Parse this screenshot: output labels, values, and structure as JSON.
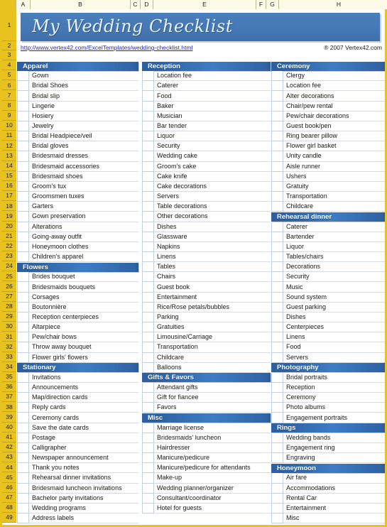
{
  "document": {
    "title": "My Wedding Checklist",
    "url": "http://www.vertex42.com/ExcelTemplates/wedding-checklist.html",
    "copyright": "® 2007 Vertex42.com"
  },
  "colors": {
    "banner_blue": "#4a7ebb",
    "section_blue": "#2f62a3",
    "frame_yellow": "#e8c21e",
    "link_blue": "#2a2ab4"
  },
  "column_headers": [
    "A",
    "B",
    "C",
    "D",
    "E",
    "F",
    "G",
    "H"
  ],
  "row_numbers": [
    1,
    2,
    3,
    4,
    5,
    6,
    7,
    8,
    9,
    10,
    11,
    12,
    13,
    14,
    15,
    16,
    17,
    18,
    19,
    20,
    21,
    22,
    23,
    24,
    25,
    26,
    27,
    28,
    29,
    30,
    31,
    32,
    33,
    34,
    35,
    36,
    37,
    38,
    39,
    40,
    41,
    42,
    43,
    44,
    45,
    46,
    47,
    48,
    49
  ],
  "columns": {
    "left": [
      {
        "type": "section",
        "label": "Apparel"
      },
      {
        "type": "item",
        "label": "Gown"
      },
      {
        "type": "item",
        "label": "Bridal Shoes"
      },
      {
        "type": "item",
        "label": "Bridal slip"
      },
      {
        "type": "item",
        "label": "Lingerie"
      },
      {
        "type": "item",
        "label": "Hosiery"
      },
      {
        "type": "item",
        "label": "Jewelry"
      },
      {
        "type": "item",
        "label": "Bridal Headpiece/veil"
      },
      {
        "type": "item",
        "label": "Bridal gloves"
      },
      {
        "type": "item",
        "label": "Bridesmaid dresses"
      },
      {
        "type": "item",
        "label": "Bridesmaid accessories"
      },
      {
        "type": "item",
        "label": "Bridesmaid shoes"
      },
      {
        "type": "item",
        "label": "Groom's tux"
      },
      {
        "type": "item",
        "label": "Groomsmen tuxes"
      },
      {
        "type": "item",
        "label": "Garters"
      },
      {
        "type": "item",
        "label": "Gown preservation"
      },
      {
        "type": "item",
        "label": "Alterations"
      },
      {
        "type": "item",
        "label": "Going-away outfit"
      },
      {
        "type": "item",
        "label": "Honeymoon clothes"
      },
      {
        "type": "item",
        "label": "Children's apparel"
      },
      {
        "type": "section",
        "label": "Flowers"
      },
      {
        "type": "item",
        "label": "Brides bouquet"
      },
      {
        "type": "item",
        "label": "Bridesmaids bouquets"
      },
      {
        "type": "item",
        "label": "Corsages"
      },
      {
        "type": "item",
        "label": "Boutonnière"
      },
      {
        "type": "item",
        "label": "Reception centerpieces"
      },
      {
        "type": "item",
        "label": "Altarpiece"
      },
      {
        "type": "item",
        "label": "Pew/chair bows"
      },
      {
        "type": "item",
        "label": "Throw away bouquet"
      },
      {
        "type": "item",
        "label": "Flower girls' flowers"
      },
      {
        "type": "section",
        "label": "Stationary"
      },
      {
        "type": "item",
        "label": "Invitations"
      },
      {
        "type": "item",
        "label": "Announcements"
      },
      {
        "type": "item",
        "label": "Map/direction cards"
      },
      {
        "type": "item",
        "label": "Reply cards"
      },
      {
        "type": "item",
        "label": "Ceremony cards"
      },
      {
        "type": "item",
        "label": "Save the date cards"
      },
      {
        "type": "item",
        "label": "Postage"
      },
      {
        "type": "item",
        "label": "Calligrapher"
      },
      {
        "type": "item",
        "label": "Newspaper announcement"
      },
      {
        "type": "item",
        "label": "Thank you notes"
      },
      {
        "type": "item",
        "label": "Rehearsal dinner invitations"
      },
      {
        "type": "item",
        "label": "Bridesmaid luncheon invitations"
      },
      {
        "type": "item",
        "label": "Bachelor party invitations"
      },
      {
        "type": "item",
        "label": "Wedding programs"
      },
      {
        "type": "item",
        "label": "Address labels"
      }
    ],
    "middle": [
      {
        "type": "section",
        "label": "Reception"
      },
      {
        "type": "item",
        "label": "Location fee"
      },
      {
        "type": "item",
        "label": "Caterer"
      },
      {
        "type": "item",
        "label": "Food"
      },
      {
        "type": "item",
        "label": "Baker"
      },
      {
        "type": "item",
        "label": "Musician"
      },
      {
        "type": "item",
        "label": "Bar tender"
      },
      {
        "type": "item",
        "label": "Liquor"
      },
      {
        "type": "item",
        "label": "Security"
      },
      {
        "type": "item",
        "label": "Wedding cake"
      },
      {
        "type": "item",
        "label": "Groom's cake"
      },
      {
        "type": "item",
        "label": "Cake knife"
      },
      {
        "type": "item",
        "label": "Cake decorations"
      },
      {
        "type": "item",
        "label": "Servers"
      },
      {
        "type": "item",
        "label": "Table decorations"
      },
      {
        "type": "item",
        "label": "Other decorations"
      },
      {
        "type": "item",
        "label": "Dishes"
      },
      {
        "type": "item",
        "label": "Glassware"
      },
      {
        "type": "item",
        "label": "Napkins"
      },
      {
        "type": "item",
        "label": "Linens"
      },
      {
        "type": "item",
        "label": "Tables"
      },
      {
        "type": "item",
        "label": "Chairs"
      },
      {
        "type": "item",
        "label": "Guest book"
      },
      {
        "type": "item",
        "label": "Entertainment"
      },
      {
        "type": "item",
        "label": "Rice/Rose petals/bubbles"
      },
      {
        "type": "item",
        "label": "Parking"
      },
      {
        "type": "item",
        "label": "Gratuities"
      },
      {
        "type": "item",
        "label": "Limousine/Carriage"
      },
      {
        "type": "item",
        "label": "Transportation"
      },
      {
        "type": "item",
        "label": "Childcare"
      },
      {
        "type": "item",
        "label": "Balloons"
      },
      {
        "type": "section",
        "label": "Gifts & Favors"
      },
      {
        "type": "item",
        "label": "Attendant gifts"
      },
      {
        "type": "item",
        "label": "Gift for fiancee"
      },
      {
        "type": "item",
        "label": "Favors"
      },
      {
        "type": "section",
        "label": "Misc"
      },
      {
        "type": "item",
        "label": "Marriage license"
      },
      {
        "type": "item",
        "label": "Bridesmaids' luncheon"
      },
      {
        "type": "item",
        "label": "Hairdresser"
      },
      {
        "type": "item",
        "label": "Manicure/pedicure"
      },
      {
        "type": "item",
        "label": "Manicure/pedicure for attendants"
      },
      {
        "type": "item",
        "label": "Make-up"
      },
      {
        "type": "item",
        "label": "Wedding planner/organizer"
      },
      {
        "type": "item",
        "label": "Consultant/coordinator"
      },
      {
        "type": "item",
        "label": "Hotel for guests"
      }
    ],
    "right": [
      {
        "type": "section",
        "label": "Ceremony"
      },
      {
        "type": "item",
        "label": "Clergy"
      },
      {
        "type": "item",
        "label": "Location fee"
      },
      {
        "type": "item",
        "label": "Alter decorations"
      },
      {
        "type": "item",
        "label": "Chair/pew rental"
      },
      {
        "type": "item",
        "label": "Pew/chair decorations"
      },
      {
        "type": "item",
        "label": "Guest book/pen"
      },
      {
        "type": "item",
        "label": "Ring bearer pillow"
      },
      {
        "type": "item",
        "label": "Flower girl basket"
      },
      {
        "type": "item",
        "label": "Unity candle"
      },
      {
        "type": "item",
        "label": "Aisle runner"
      },
      {
        "type": "item",
        "label": "Ushers"
      },
      {
        "type": "item",
        "label": "Gratuity"
      },
      {
        "type": "item",
        "label": "Transportation"
      },
      {
        "type": "item",
        "label": "Childcare"
      },
      {
        "type": "section",
        "label": "Rehearsal dinner"
      },
      {
        "type": "item",
        "label": "Caterer"
      },
      {
        "type": "item",
        "label": "Bartender"
      },
      {
        "type": "item",
        "label": "Liquor"
      },
      {
        "type": "item",
        "label": "Tables/chairs"
      },
      {
        "type": "item",
        "label": "Decorations"
      },
      {
        "type": "item",
        "label": "Security"
      },
      {
        "type": "item",
        "label": "Music"
      },
      {
        "type": "item",
        "label": "Sound system"
      },
      {
        "type": "item",
        "label": "Guest parking"
      },
      {
        "type": "item",
        "label": "Dishes"
      },
      {
        "type": "item",
        "label": "Centerpieces"
      },
      {
        "type": "item",
        "label": "Linens"
      },
      {
        "type": "item",
        "label": "Food"
      },
      {
        "type": "item",
        "label": "Servers"
      },
      {
        "type": "section",
        "label": "Photography"
      },
      {
        "type": "item",
        "label": "Bridal portraits"
      },
      {
        "type": "item",
        "label": "Reception"
      },
      {
        "type": "item",
        "label": "Ceremony"
      },
      {
        "type": "item",
        "label": "Photo albums"
      },
      {
        "type": "item",
        "label": "Engagement portraits"
      },
      {
        "type": "section",
        "label": "Rings"
      },
      {
        "type": "item",
        "label": "Wedding bands"
      },
      {
        "type": "item",
        "label": "Engagement ring"
      },
      {
        "type": "item",
        "label": "Engraving"
      },
      {
        "type": "section",
        "label": "Honeymoon"
      },
      {
        "type": "item",
        "label": "Air fare"
      },
      {
        "type": "item",
        "label": "Accommodations"
      },
      {
        "type": "item",
        "label": "Rental Car"
      },
      {
        "type": "item",
        "label": "Entertainment"
      },
      {
        "type": "item",
        "label": "Misc"
      }
    ]
  }
}
